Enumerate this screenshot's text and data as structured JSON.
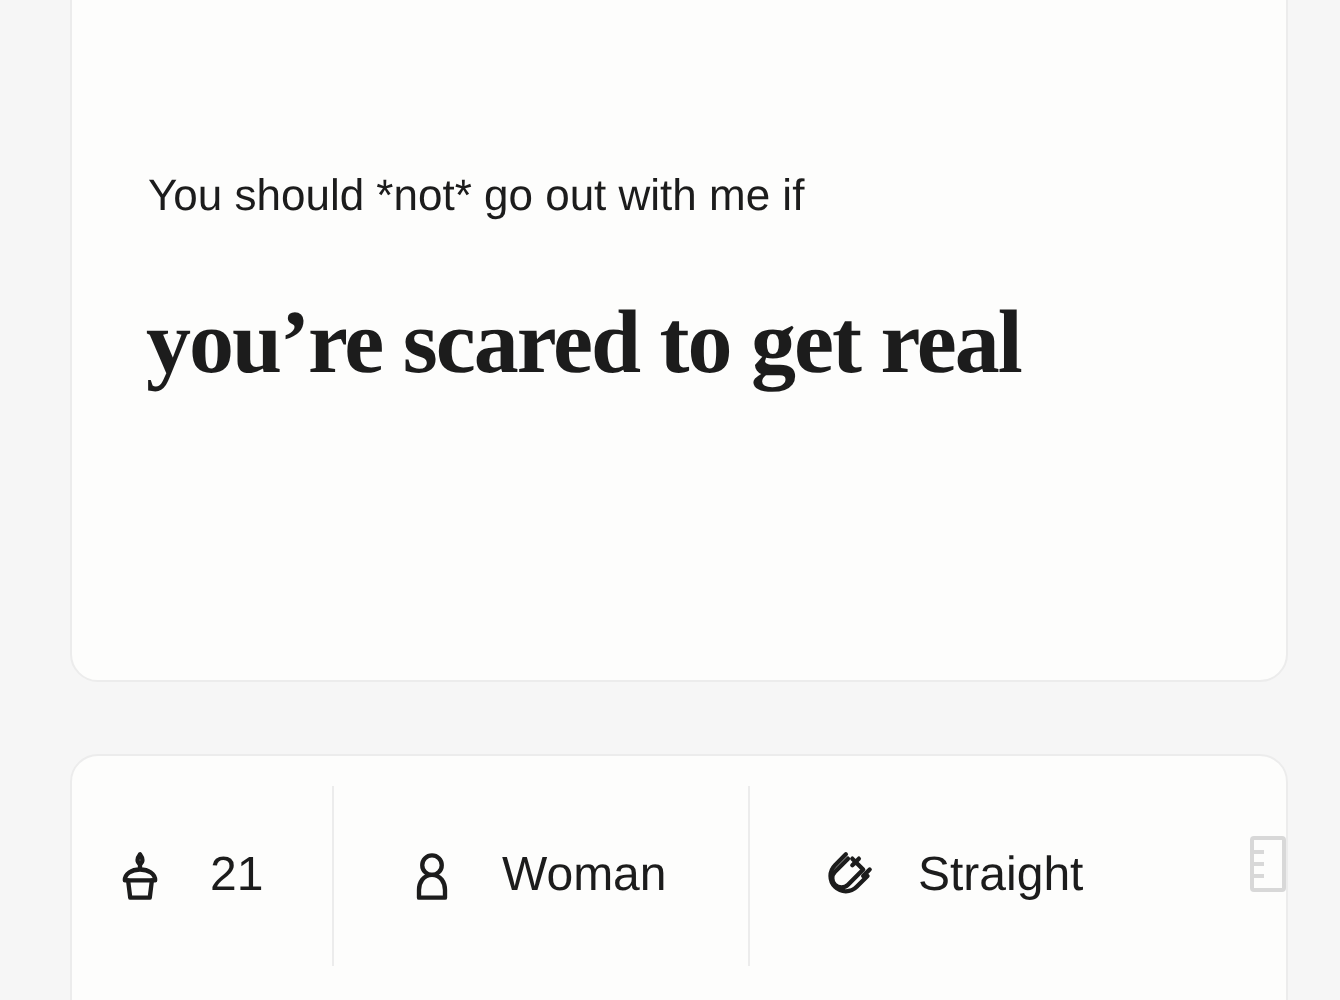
{
  "prompt_card": {
    "prompt": "You should *not* go out with me if",
    "answer": "you’re scared to get real"
  },
  "vitals": [
    {
      "kind": "age",
      "label": "21"
    },
    {
      "kind": "gender",
      "label": "Woman"
    },
    {
      "kind": "orientation",
      "label": "Straight"
    }
  ]
}
